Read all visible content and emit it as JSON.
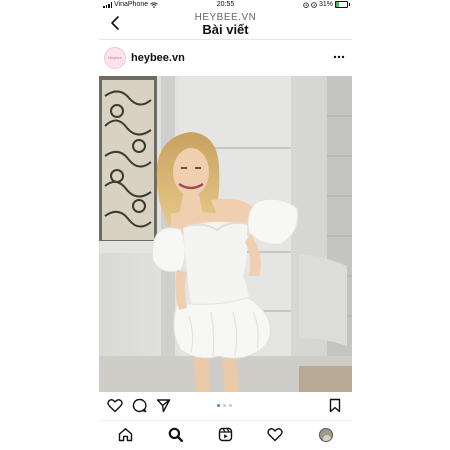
{
  "status_bar": {
    "carrier": "VinaPhone",
    "time": "20:55",
    "battery": "31%",
    "battery_level": 0.31,
    "icons": [
      "signal-icon",
      "wifi-icon",
      "alarm-icon",
      "location-icon",
      "battery-icon"
    ]
  },
  "header": {
    "watermark": "HEYBEE.VN",
    "title": "Bài viết",
    "back_icon": "chevron-left-icon"
  },
  "post": {
    "username": "heybee.vn",
    "avatar_text": "Heybee",
    "more_icon": "more-horizontal-icon",
    "image_alt": "Woman in white off-shoulder puff-sleeve mini dress in front of a white building",
    "carousel": {
      "current": 1,
      "total": 3
    },
    "actions": [
      "heart-icon",
      "comment-icon",
      "share-icon",
      "bookmark-icon"
    ]
  },
  "tab_bar": {
    "items": [
      "home-icon",
      "search-icon",
      "reels-icon",
      "heart-icon",
      "profile-avatar"
    ],
    "active": "search-icon"
  },
  "colors": {
    "accent_dot": "#2f8fe8",
    "inactive_dot": "#c8c8c8",
    "battery_fill": "#3cc24a"
  }
}
